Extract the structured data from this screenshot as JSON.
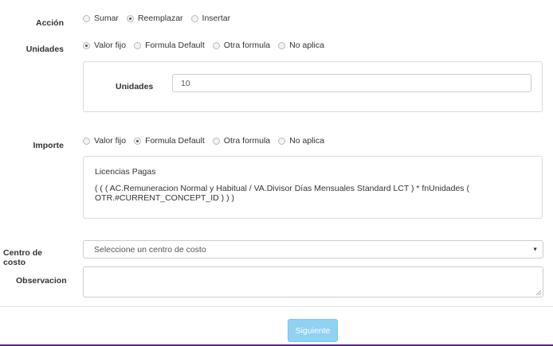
{
  "accion": {
    "label": "Acción",
    "options": [
      {
        "label": "Sumar",
        "checked": false
      },
      {
        "label": "Reemplazar",
        "checked": true
      },
      {
        "label": "Insertar",
        "checked": false
      }
    ]
  },
  "unidades": {
    "label": "Unidades",
    "options": [
      {
        "label": "Valor fijo",
        "checked": true
      },
      {
        "label": "Formula Default",
        "checked": false
      },
      {
        "label": "Otra formula",
        "checked": false
      },
      {
        "label": "No aplica",
        "checked": false
      }
    ],
    "panel": {
      "field_label": "Unidades",
      "value": "10"
    }
  },
  "importe": {
    "label": "Importe",
    "options": [
      {
        "label": "Valor fijo",
        "checked": false
      },
      {
        "label": "Formula Default",
        "checked": true
      },
      {
        "label": "Otra formula",
        "checked": false
      },
      {
        "label": "No aplica",
        "checked": false
      }
    ],
    "panel": {
      "title": "Licencias Pagas",
      "formula_line1": "( ( ( AC.Remuneracion Normal y Habitual / VA.Divisor Días Mensuales Standard LCT ) * fnUnidades (",
      "formula_line2": "OTR.#CURRENT_CONCEPT_ID ) ) )"
    }
  },
  "centro_costo": {
    "label": "Centro de costo",
    "placeholder": "Seleccione un centro de costo"
  },
  "observacion": {
    "label": "Observacion",
    "value": ""
  },
  "actions": {
    "next_label": "Siguiente"
  },
  "colors": {
    "primary_button": "#8fd2f3",
    "bottom_accent": "#5b2d86"
  }
}
